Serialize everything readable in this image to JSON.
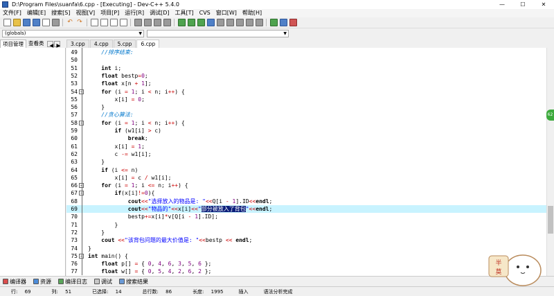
{
  "window": {
    "title": "D:\\Program Files\\suanfa\\6.cpp - [Executing] - Dev-C++ 5.4.0"
  },
  "menu": [
    "文件[F]",
    "编辑[E]",
    "搜索[S]",
    "视图[V]",
    "项目[P]",
    "运行[R]",
    "调试[D]",
    "工具[T]",
    "CVS",
    "窗口[W]",
    "帮助[H]"
  ],
  "scope_combo": "(globals)",
  "panel_tabs": [
    "项目管理",
    "查看类"
  ],
  "file_tabs": [
    "3.cpp",
    "4.cpp",
    "5.cpp",
    "6.cpp"
  ],
  "active_file_tab": 3,
  "code_lines": [
    {
      "n": "49",
      "t": "    //排序结束:"
    },
    {
      "n": "50",
      "t": ""
    },
    {
      "n": "51",
      "t": "    int i;"
    },
    {
      "n": "52",
      "t": "    float bestp=0;"
    },
    {
      "n": "53",
      "t": "    float x[n + 1];"
    },
    {
      "n": "54",
      "t": "    for (i = 1; i < n; i++) {"
    },
    {
      "n": "55",
      "t": "        x[i] = 0;"
    },
    {
      "n": "56",
      "t": "    }"
    },
    {
      "n": "57",
      "t": "    //贪心算法:"
    },
    {
      "n": "58",
      "t": "    for (i = 1; i < n; i++) {"
    },
    {
      "n": "59",
      "t": "        if (w1[i] > c)"
    },
    {
      "n": "60",
      "t": "            break;"
    },
    {
      "n": "61",
      "t": "        x[i] = 1;"
    },
    {
      "n": "62",
      "t": "        c -= w1[i];"
    },
    {
      "n": "63",
      "t": "    }"
    },
    {
      "n": "64",
      "t": "    if (i <= n)"
    },
    {
      "n": "65",
      "t": "        x[i] = c / w1[i];"
    },
    {
      "n": "66",
      "t": "    for (i = 1; i <= n; i++) {"
    },
    {
      "n": "67",
      "t": "        if(x[i]!=0){"
    },
    {
      "n": "68",
      "t": "            cout<<\"选择放入的物品是: \"<<Q[i - 1].ID<<endl;"
    },
    {
      "n": "69",
      "t": "            cout<<\"物品的\"<<x[i]<<\"部分被放入了背包\"<<endl;"
    },
    {
      "n": "70",
      "t": "            bestp+=x[i]*v[Q[i - 1].ID];"
    },
    {
      "n": "71",
      "t": "        }"
    },
    {
      "n": "72",
      "t": "    }"
    },
    {
      "n": "73",
      "t": "    cout <<\"该背包问题的最大价值是: \"<<bestp << endl;"
    },
    {
      "n": "74",
      "t": "}"
    },
    {
      "n": "75",
      "t": "int main() {"
    },
    {
      "n": "76",
      "t": "    float p[] = { 0, 4, 6, 3, 5, 6 };"
    },
    {
      "n": "77",
      "t": "    float w[] = { 0, 5, 4, 2, 6, 2 };"
    }
  ],
  "highlighted_line": "69",
  "selected_text": "部分被放入了背包",
  "bottom_tabs": [
    "编译器",
    "资源",
    "编译日志",
    "调试",
    "搜索结果"
  ],
  "status": {
    "row_label": "行:",
    "row": "69",
    "col_label": "列:",
    "col": "51",
    "sel_label": "已选择:",
    "sel": "14",
    "total_label": "总行数:",
    "total": "86",
    "length_label": "长度:",
    "length": "1995",
    "mode": "插入",
    "parse": "语法分析完成"
  },
  "mascot_text": [
    "半",
    "莫"
  ]
}
